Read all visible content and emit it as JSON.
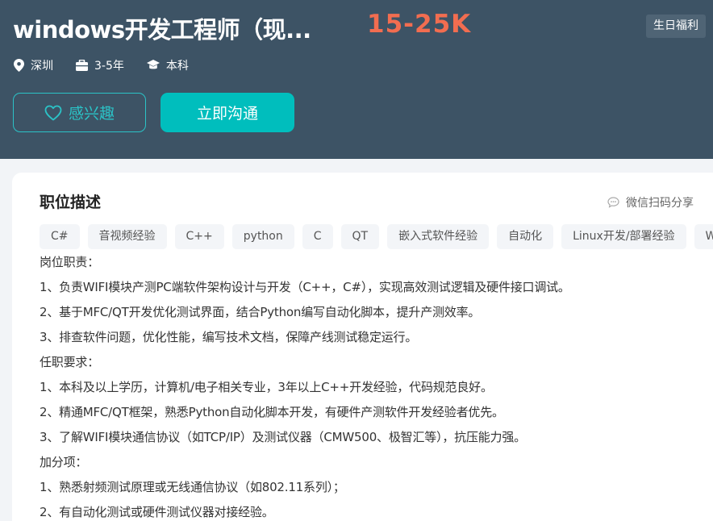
{
  "header": {
    "title": "windows开发工程师（现...",
    "salary": "15-25K",
    "benefit": "生日福利",
    "meta": [
      {
        "icon": "location-pin-icon",
        "text": "深圳"
      },
      {
        "icon": "briefcase-icon",
        "text": "3-5年"
      },
      {
        "icon": "graduation-cap-icon",
        "text": "本科"
      }
    ],
    "interest_label": "感兴趣",
    "chat_label": "立即沟通"
  },
  "description": {
    "title": "职位描述",
    "share_label": "微信扫码分享",
    "tags": [
      "C#",
      "音视频经验",
      "C++",
      "python",
      "C",
      "QT",
      "嵌入式软件经验",
      "自动化",
      "Linux开发/部署经验",
      "W"
    ],
    "lines": [
      "岗位职责：",
      "1、负责WIFI模块产测PC端软件架构设计与开发（C++，C#），实现高效测试逻辑及硬件接口调试。",
      "2、基于MFC/QT开发优化测试界面，结合Python编写自动化脚本，提升产测效率。",
      "3、排查软件问题，优化性能，编写技术文档，保障产线测试稳定运行。",
      "任职要求：",
      "1、本科及以上学历，计算机/电子相关专业，3年以上C++开发经验，代码规范良好。",
      "2、精通MFC/QT框架，熟悉Python自动化脚本开发，有硬件产测软件开发经验者优先。",
      "3、了解WIFI模块通信协议（如TCP/IP）及测试仪器（CMW500、极智汇等），抗压能力强。",
      "加分项：",
      "1、熟悉射频测试原理或无线通信协议（如802.11系列）；",
      "2、有自动化测试或硬件测试仪器对接经验。"
    ]
  },
  "colors": {
    "header_bg": "#3d5365",
    "salary": "#f26d50",
    "accent": "#00bebd"
  }
}
